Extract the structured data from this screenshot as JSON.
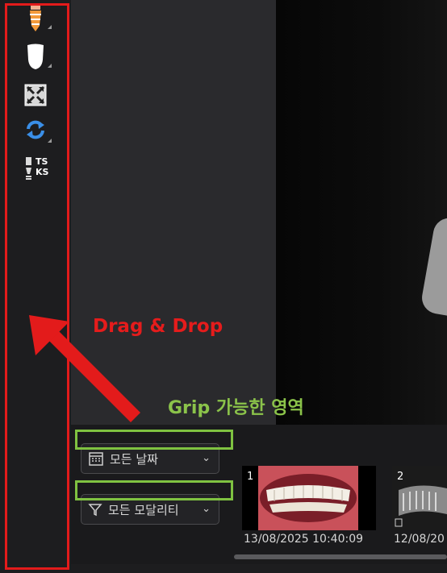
{
  "annotations": {
    "drag_drop": "Drag & Drop",
    "grip_area": "Grip 가능한 영역"
  },
  "toolbar": {
    "tools": [
      {
        "icon": "implant-icon"
      },
      {
        "icon": "tooth-crown-icon"
      },
      {
        "icon": "fit-to-window-icon"
      },
      {
        "icon": "rotate-sync-icon"
      },
      {
        "icon": "ts-ks-icon",
        "top": "TS",
        "bottom": "KS"
      }
    ]
  },
  "filters": {
    "date": "모든 날짜",
    "modality": "모든 모달리티"
  },
  "thumbnails": [
    {
      "number": "1",
      "timestamp": "13/08/2025  10:40:09"
    },
    {
      "number": "2",
      "timestamp": "12/08/20"
    }
  ],
  "colors": {
    "annotation_red": "#e31b1b",
    "annotation_green": "#7fc241"
  }
}
